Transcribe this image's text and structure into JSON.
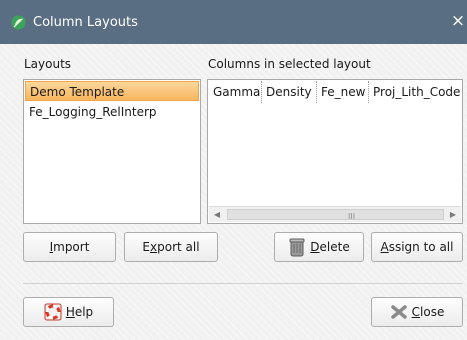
{
  "window": {
    "title": "Column Layouts",
    "close_glyph": "×"
  },
  "layouts": {
    "label": "Layouts",
    "items": [
      {
        "name": "Demo Template",
        "selected": true
      },
      {
        "name": "Fe_Logging_RelInterp",
        "selected": false
      }
    ]
  },
  "columns": {
    "label": "Columns in selected layout",
    "headers": [
      "Gamma",
      "Density",
      "Fe_new",
      "Proj_Lith_Code"
    ],
    "scroll_grip": "III"
  },
  "buttons": {
    "import": {
      "underline": "I",
      "rest": "mport"
    },
    "export_all": {
      "pre": "E",
      "underline": "x",
      "rest": "port all"
    },
    "delete": {
      "underline": "D",
      "rest": "elete"
    },
    "assign_to_all": {
      "underline": "A",
      "rest": "ssign to all"
    },
    "help": {
      "underline": "H",
      "rest": "elp"
    },
    "close": {
      "underline": "C",
      "rest": "lose"
    }
  },
  "icons": {
    "app": "leaf-logo-icon",
    "delete": "trash-can-icon",
    "help": "lifebuoy-icon",
    "close": "x-mark-icon"
  },
  "colors": {
    "titlebar": "#5a6e83",
    "selection": "#f7b55f"
  }
}
